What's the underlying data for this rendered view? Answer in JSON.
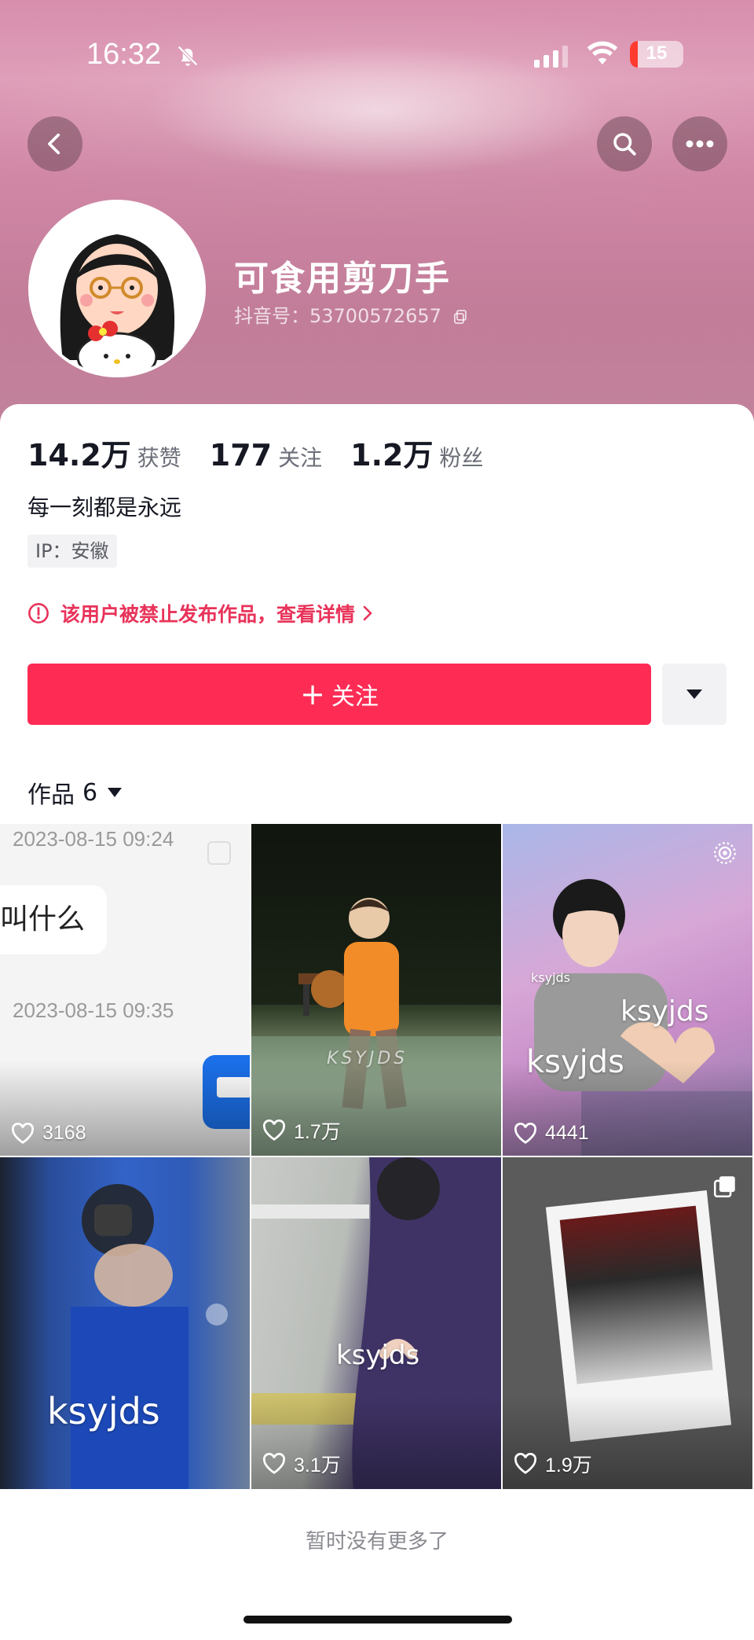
{
  "status_bar": {
    "time": "16:32",
    "battery": "15",
    "battery_level_pct": 15
  },
  "profile": {
    "nickname": "可食用剪刀手",
    "douyin_id": "抖音号：53700572657",
    "stats": [
      {
        "num": "14.2万",
        "label": "获赞"
      },
      {
        "num": "177",
        "label": "关注"
      },
      {
        "num": "1.2万",
        "label": "粉丝"
      }
    ],
    "bio": "每一刻都是永远",
    "ip": "IP：安徽",
    "ban_notice": "该用户被禁止发布作品，查看详情",
    "follow_label": "关注",
    "follow_plus": "+"
  },
  "works_tab": {
    "label": "作品",
    "count": "6"
  },
  "works": [
    {
      "likes": "3168",
      "ts1": "2023-08-15 09:24",
      "bubble": "叫什么",
      "ts2": "2023-08-15 09:35"
    },
    {
      "likes": "1.7万",
      "watermark": "KSYJDS"
    },
    {
      "likes": "4441",
      "watermark": "ksyjds",
      "watermark2": "ksyjds",
      "watermark3": "ksyjds"
    },
    {
      "likes": "",
      "watermark": "ksyjds"
    },
    {
      "likes": "3.1万",
      "watermark": "ksyjds"
    },
    {
      "likes": "1.9万"
    }
  ],
  "footer": {
    "no_more": "暂时没有更多了"
  },
  "colors": {
    "accent": "#fe2c55",
    "warning": "#e8335a"
  },
  "icons": [
    "back-icon",
    "search-icon",
    "more-icon",
    "copy-icon",
    "warning-icon",
    "chevron-right-icon",
    "dropdown-icon",
    "heart-icon",
    "multi-image-icon",
    "live-photo-icon"
  ]
}
